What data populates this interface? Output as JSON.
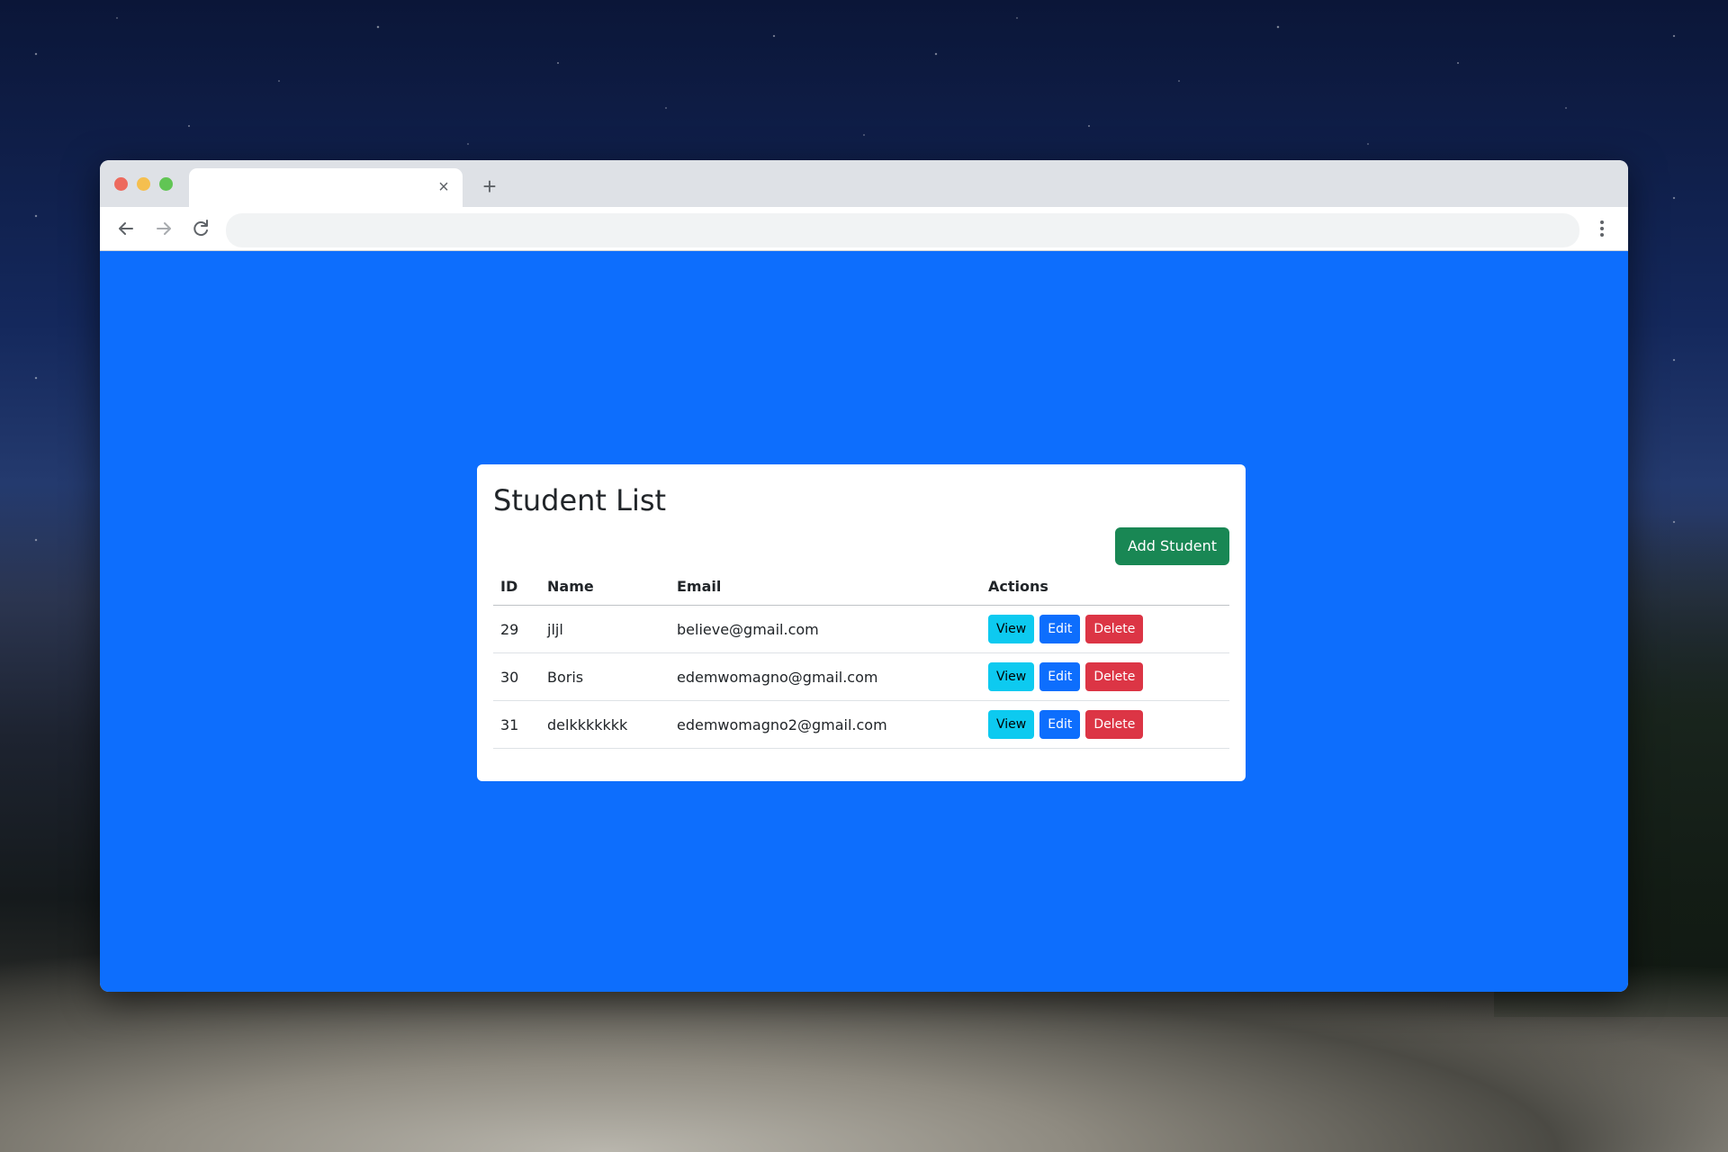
{
  "browser": {
    "tab_close_glyph": "×",
    "new_tab_glyph": "+",
    "address_value": ""
  },
  "page": {
    "title": "Student List",
    "add_button_label": "Add Student",
    "columns": [
      "ID",
      "Name",
      "Email",
      "Actions"
    ],
    "rows": [
      {
        "id": "29",
        "name": "jljl",
        "email": "believe@gmail.com"
      },
      {
        "id": "30",
        "name": "Boris",
        "email": "edemwomagno@gmail.com"
      },
      {
        "id": "31",
        "name": "delkkkkkkk",
        "email": "edemwomagno2@gmail.com"
      }
    ],
    "actions": {
      "view_label": "View",
      "edit_label": "Edit",
      "delete_label": "Delete"
    }
  },
  "colors": {
    "page_background": "#0d6efd",
    "add_button": "#198754",
    "view_button": "#0dcaf0",
    "edit_button": "#0d6efd",
    "delete_button": "#dc3545"
  },
  "icons": {
    "back": "arrow-left-icon",
    "forward": "arrow-right-icon",
    "reload": "reload-icon",
    "menu": "kebab-menu-icon"
  }
}
